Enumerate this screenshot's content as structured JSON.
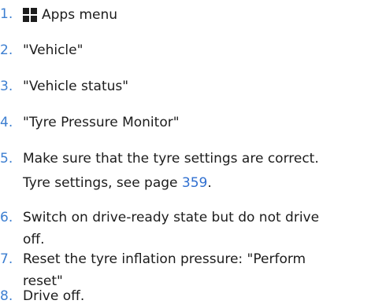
{
  "steps": [
    {
      "num": "1.",
      "icon": "apps-grid-icon",
      "text": "Apps menu"
    },
    {
      "num": "2.",
      "text": "\"Vehicle\""
    },
    {
      "num": "3.",
      "text": "\"Vehicle status\""
    },
    {
      "num": "4.",
      "text": "\"Tyre Pressure Monitor\""
    },
    {
      "num": "5.",
      "text": "Make sure that the tyre settings are correct.",
      "note_prefix": "Tyre settings, see page ",
      "note_page": "359",
      "note_suffix": "."
    },
    {
      "num": "6.",
      "line1": "Switch on drive-ready state but do not drive",
      "line2": "off."
    },
    {
      "num": "7.",
      "line1": "Reset the tyre inflation pressure: \"Perform",
      "line2": "reset\""
    },
    {
      "num": "8.",
      "text": "Drive off."
    }
  ],
  "colors": {
    "number": "#3d7fd1",
    "link": "#2f6fd0",
    "text": "#1c1c1c"
  }
}
